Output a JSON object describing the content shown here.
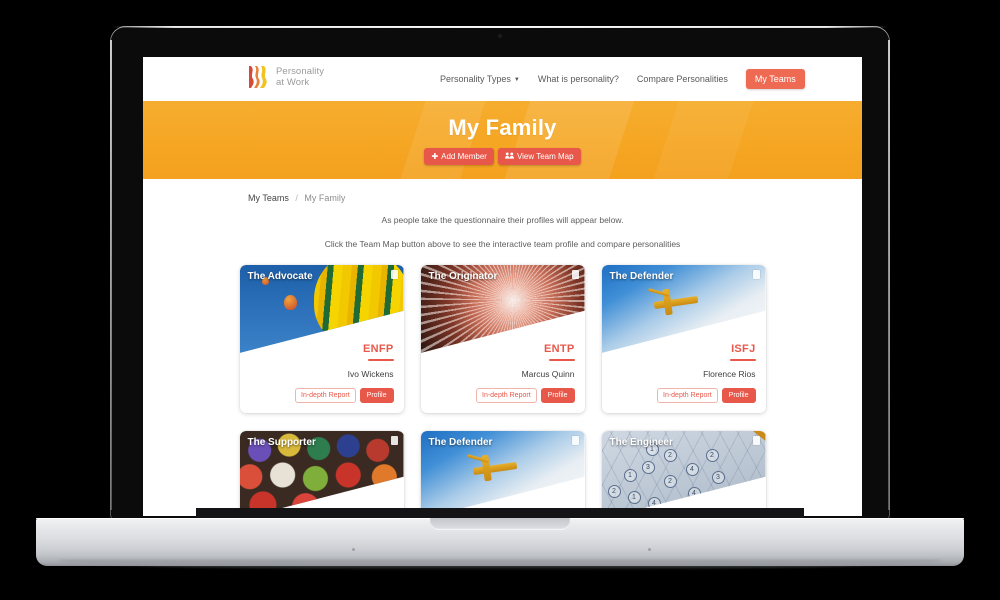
{
  "navbar": {
    "brand": {
      "line1": "Personality",
      "line2": "at Work",
      "mark_colors": [
        "#d64a3a",
        "#e8823a",
        "#f2c21e"
      ]
    },
    "links": [
      {
        "label": "Personality Types",
        "has_caret": true,
        "caret_icon": "chevron-down-icon"
      },
      {
        "label": "What is personality?",
        "has_caret": false
      },
      {
        "label": "Compare Personalities",
        "has_caret": false
      }
    ],
    "cta": {
      "label": "My Teams",
      "color": "#ef6a52"
    }
  },
  "hero": {
    "title": "My Family",
    "bg_color": "#f5a623",
    "buttons": [
      {
        "label": "Add Member",
        "icon": "plus-icon",
        "glyph": "✚",
        "color": "#e8584a"
      },
      {
        "label": "View Team Map",
        "icon": "users-group-icon",
        "glyph": "⚎",
        "color": "#e8584a"
      }
    ]
  },
  "breadcrumb": {
    "parent": "My Teams",
    "separator": "/",
    "current": "My Family"
  },
  "intro": {
    "line1": "As people take the questionnaire their profiles will appear below.",
    "line2": "Click the Team Map button above to see the interactive team profile and compare personalities"
  },
  "card_actions": {
    "report_label": "In-depth Report",
    "profile_label": "Profile",
    "accent_color": "#e8584a"
  },
  "cards": [
    {
      "type_title": "The Advocate",
      "code": "ENFP",
      "name": "Ivo Wickens",
      "art": "hot-air-balloons",
      "corner_icon": "document-icon"
    },
    {
      "type_title": "The Originator",
      "code": "ENTP",
      "name": "Marcus Quinn",
      "art": "fireworks",
      "corner_icon": "document-icon"
    },
    {
      "type_title": "The Defender",
      "code": "ISFJ",
      "name": "Florence Rios",
      "art": "yellow-plane-sky",
      "corner_icon": "document-icon"
    },
    {
      "type_title": "The Supporter",
      "code": "",
      "name": "",
      "art": "colored-crayons",
      "corner_icon": "document-icon"
    },
    {
      "type_title": "The Defender",
      "code": "",
      "name": "",
      "art": "yellow-plane-sky",
      "corner_icon": "document-icon"
    },
    {
      "type_title": "The Engineer",
      "code": "",
      "name": "",
      "art": "puzzle-numbers-pencil",
      "corner_icon": "document-icon"
    }
  ],
  "puzzle_numbers": [
    "2",
    "1",
    "4",
    "1",
    "3",
    "2",
    "4",
    "2",
    "1",
    "2",
    "4",
    "3"
  ]
}
